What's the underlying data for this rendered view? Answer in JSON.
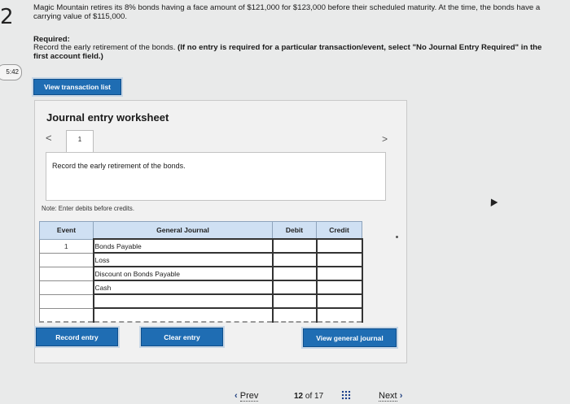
{
  "question": {
    "number": "2",
    "timer": "5:42",
    "text": "Magic Mountain retires its 8% bonds having a face amount of $121,000 for $123,000 before their scheduled maturity. At the time, the bonds have a carrying value of $115,000.",
    "required_title": "Required:",
    "required_text": "Record the early retirement of the bonds. ",
    "required_bold": "(If no entry is required for a particular transaction/event, select \"No Journal Entry Required\" in the first account field.)"
  },
  "buttons": {
    "view_transactions": "View transaction list",
    "record_entry": "Record entry",
    "clear_entry": "Clear entry",
    "view_general_journal": "View general journal"
  },
  "worksheet": {
    "title": "Journal entry worksheet",
    "prev_arrow": "<",
    "next_arrow": ">",
    "tab_label": "1",
    "description": "Record the early retirement of the bonds.",
    "note": "Note: Enter debits before credits."
  },
  "journal": {
    "headers": {
      "event": "Event",
      "general_journal": "General Journal",
      "debit": "Debit",
      "credit": "Credit"
    },
    "rows": [
      {
        "event": "1",
        "account": "Bonds Payable",
        "debit": "",
        "credit": ""
      },
      {
        "event": "",
        "account": "Loss",
        "debit": "",
        "credit": ""
      },
      {
        "event": "",
        "account": "Discount on Bonds Payable",
        "debit": "",
        "credit": ""
      },
      {
        "event": "",
        "account": "Cash",
        "debit": "",
        "credit": ""
      },
      {
        "event": "",
        "account": "",
        "debit": "",
        "credit": ""
      },
      {
        "event": "",
        "account": "",
        "debit": "",
        "credit": ""
      }
    ]
  },
  "footer": {
    "prev": "Prev",
    "current_page": "12",
    "of": "of",
    "total_pages": "17",
    "next": "Next"
  }
}
